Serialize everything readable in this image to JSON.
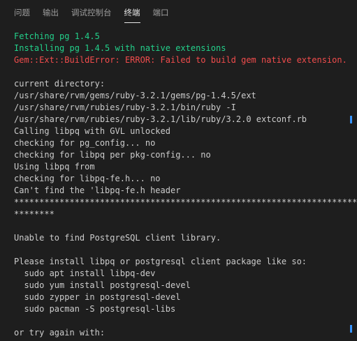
{
  "panel": {
    "tabs": [
      {
        "label": "问题"
      },
      {
        "label": "输出"
      },
      {
        "label": "调试控制台"
      },
      {
        "label": "终端",
        "active": true
      },
      {
        "label": "端口"
      }
    ]
  },
  "terminal": {
    "lines": [
      {
        "text": "Fetching pg 1.4.5",
        "style": "success"
      },
      {
        "text": "Installing pg 1.4.5 with native extensions",
        "style": "success"
      },
      {
        "text": "Gem::Ext::BuildError: ERROR: Failed to build gem native extension.",
        "style": "error"
      },
      {
        "text": "",
        "style": "normal"
      },
      {
        "text": "current directory:",
        "style": "normal"
      },
      {
        "text": "/usr/share/rvm/gems/ruby-3.2.1/gems/pg-1.4.5/ext",
        "style": "normal"
      },
      {
        "text": "/usr/share/rvm/rubies/ruby-3.2.1/bin/ruby -I",
        "style": "normal"
      },
      {
        "text": "/usr/share/rvm/rubies/ruby-3.2.1/lib/ruby/3.2.0 extconf.rb",
        "style": "normal"
      },
      {
        "text": "Calling libpq with GVL unlocked",
        "style": "normal"
      },
      {
        "text": "checking for pg_config... no",
        "style": "normal"
      },
      {
        "text": "checking for libpq per pkg-config... no",
        "style": "normal"
      },
      {
        "text": "Using libpq from",
        "style": "normal"
      },
      {
        "text": "checking for libpq-fe.h... no",
        "style": "normal"
      },
      {
        "text": "Can't find the 'libpq-fe.h header",
        "style": "normal"
      },
      {
        "text": "***************************************************************************",
        "style": "normal"
      },
      {
        "text": "********",
        "style": "normal"
      },
      {
        "text": "",
        "style": "normal"
      },
      {
        "text": "Unable to find PostgreSQL client library.",
        "style": "normal"
      },
      {
        "text": "",
        "style": "normal"
      },
      {
        "text": "Please install libpq or postgresql client package like so:",
        "style": "normal"
      },
      {
        "text": "  sudo apt install libpq-dev",
        "style": "normal"
      },
      {
        "text": "  sudo yum install postgresql-devel",
        "style": "normal"
      },
      {
        "text": "  sudo zypper in postgresql-devel",
        "style": "normal"
      },
      {
        "text": "  sudo pacman -S postgresql-libs",
        "style": "normal"
      },
      {
        "text": "",
        "style": "normal"
      },
      {
        "text": "or try again with:",
        "style": "normal"
      }
    ]
  },
  "scrollbar": {
    "accent_color": "#3794ff",
    "markers": [
      0.3,
      0.96
    ]
  }
}
